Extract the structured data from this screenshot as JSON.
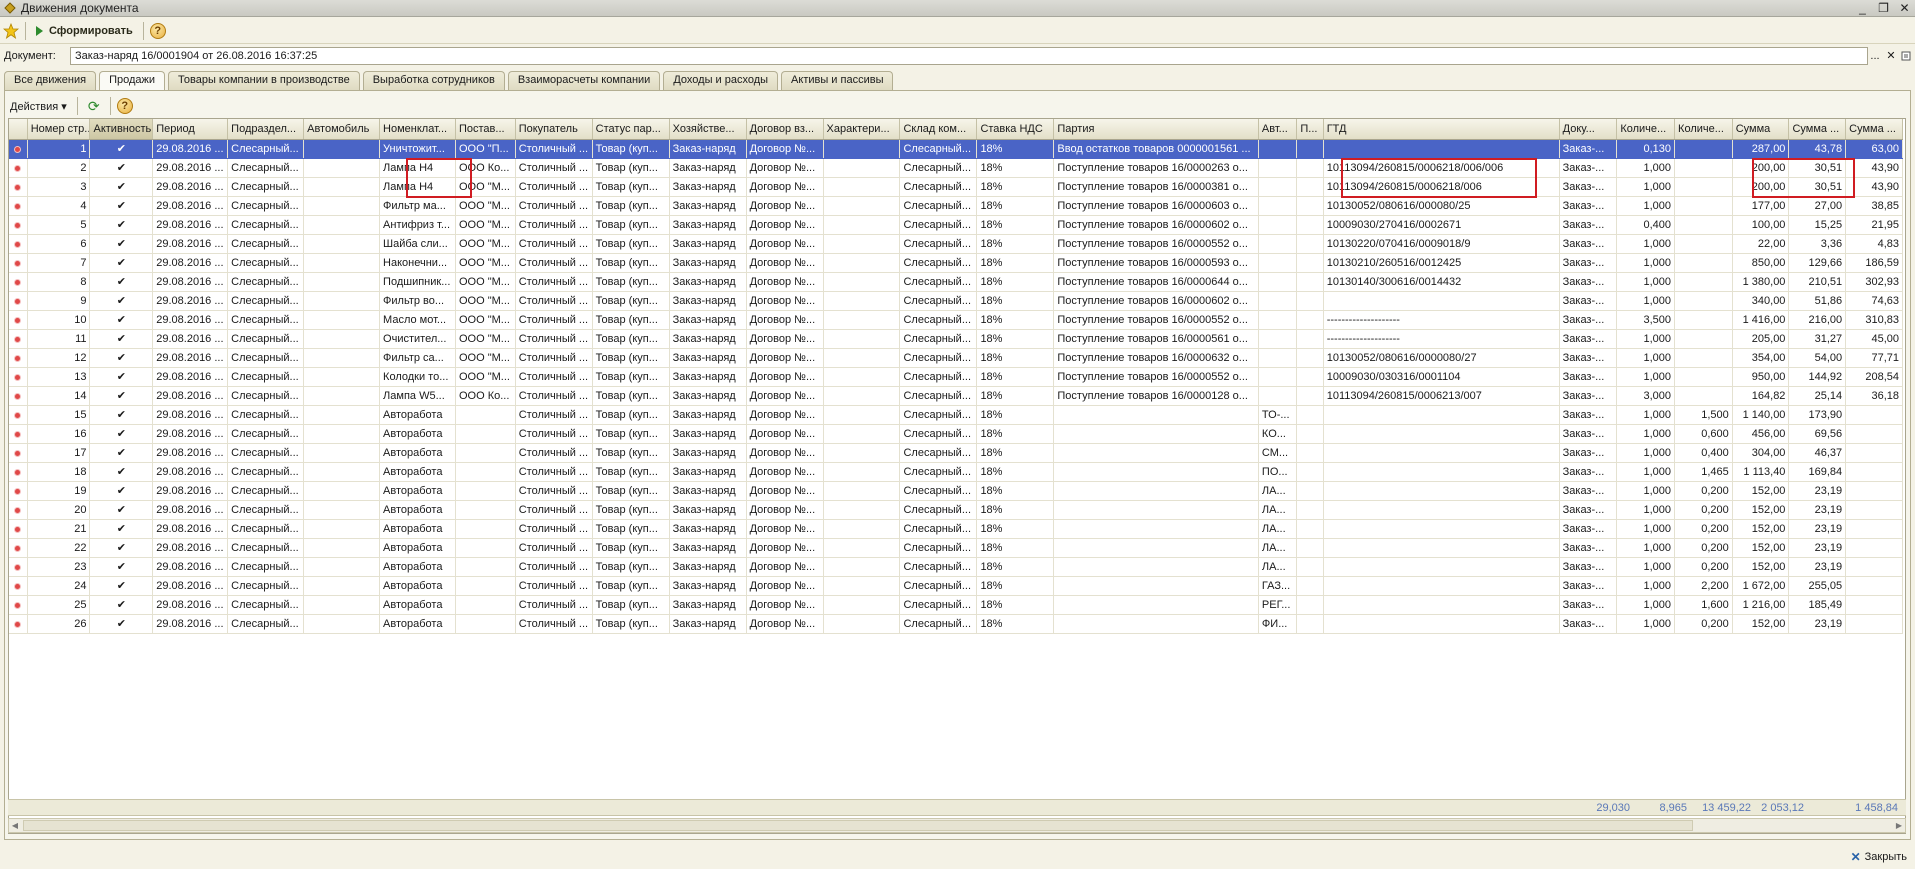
{
  "window": {
    "title": "Движения документа",
    "minimize": "_",
    "restore": "❐",
    "close": "✕"
  },
  "toolbar": {
    "form_label": "Сформировать",
    "help": "?"
  },
  "document": {
    "label": "Документ:",
    "value": "Заказ-наряд 16/0001904 от 26.08.2016 16:37:25",
    "select": "...",
    "clear": "✕"
  },
  "tabs": [
    "Все движения",
    "Продажи",
    "Товары компании в производстве",
    "Выработка сотрудников",
    "Взаиморасчеты компании",
    "Доходы и расходы",
    "Активы и пассивы"
  ],
  "actions": {
    "label": "Действия ▾",
    "refresh": "⟳",
    "help": "?"
  },
  "columns": [
    "",
    "Номер стр...",
    "Активность",
    "Период",
    "Подраздел...",
    "Автомобиль",
    "Номенклат...",
    "Постав...",
    "Покупатель",
    "Статус пар...",
    "Хозяйстве...",
    "Договор вз...",
    "Характери...",
    "Склад ком...",
    "Ставка НДС",
    "Партия",
    "Авт...",
    "П...",
    "ГТД",
    "Доку...",
    "Количе...",
    "Количе...",
    "Сумма",
    "Сумма ...",
    "Сумма ..."
  ],
  "rows": [
    [
      "1",
      "✔",
      "29.08.2016 ...",
      "Слесарный...",
      "",
      "Уничтожит...",
      "ООО \"П...",
      "Столичный ...",
      "Товар (куп...",
      "Заказ-наряд",
      "Договор №...",
      "",
      "Слесарный...",
      "18%",
      "Ввод остатков товаров 0000001561 ...",
      "",
      "",
      "",
      "Заказ-...",
      "0,130",
      "",
      "287,00",
      "43,78",
      "63,00"
    ],
    [
      "2",
      "✔",
      "29.08.2016 ...",
      "Слесарный...",
      "",
      "Лампа Н4",
      "ООО Ко...",
      "Столичный ...",
      "Товар (куп...",
      "Заказ-наряд",
      "Договор №...",
      "",
      "Слесарный...",
      "18%",
      "Поступление товаров 16/0000263 о...",
      "",
      "",
      "10113094/260815/0006218/006/006",
      "Заказ-...",
      "1,000",
      "",
      "200,00",
      "30,51",
      "43,90"
    ],
    [
      "3",
      "✔",
      "29.08.2016 ...",
      "Слесарный...",
      "",
      "Лампа Н4",
      "ООО \"М...",
      "Столичный ...",
      "Товар (куп...",
      "Заказ-наряд",
      "Договор №...",
      "",
      "Слесарный...",
      "18%",
      "Поступление товаров 16/0000381 о...",
      "",
      "",
      "10113094/260815/0006218/006",
      "Заказ-...",
      "1,000",
      "",
      "200,00",
      "30,51",
      "43,90"
    ],
    [
      "4",
      "✔",
      "29.08.2016 ...",
      "Слесарный...",
      "",
      "Фильтр ма...",
      "ООО \"М...",
      "Столичный ...",
      "Товар (куп...",
      "Заказ-наряд",
      "Договор №...",
      "",
      "Слесарный...",
      "18%",
      "Поступление товаров 16/0000603 о...",
      "",
      "",
      "10130052/080616/000080/25",
      "Заказ-...",
      "1,000",
      "",
      "177,00",
      "27,00",
      "38,85"
    ],
    [
      "5",
      "✔",
      "29.08.2016 ...",
      "Слесарный...",
      "",
      "Антифриз т...",
      "ООО \"М...",
      "Столичный ...",
      "Товар (куп...",
      "Заказ-наряд",
      "Договор №...",
      "",
      "Слесарный...",
      "18%",
      "Поступление товаров 16/0000602 о...",
      "",
      "",
      "10009030/270416/0002671",
      "Заказ-...",
      "0,400",
      "",
      "100,00",
      "15,25",
      "21,95"
    ],
    [
      "6",
      "✔",
      "29.08.2016 ...",
      "Слесарный...",
      "",
      "Шайба сли...",
      "ООО \"М...",
      "Столичный ...",
      "Товар (куп...",
      "Заказ-наряд",
      "Договор №...",
      "",
      "Слесарный...",
      "18%",
      "Поступление товаров 16/0000552 о...",
      "",
      "",
      "10130220/070416/0009018/9",
      "Заказ-...",
      "1,000",
      "",
      "22,00",
      "3,36",
      "4,83"
    ],
    [
      "7",
      "✔",
      "29.08.2016 ...",
      "Слесарный...",
      "",
      "Наконечни...",
      "ООО \"М...",
      "Столичный ...",
      "Товар (куп...",
      "Заказ-наряд",
      "Договор №...",
      "",
      "Слесарный...",
      "18%",
      "Поступление товаров 16/0000593 о...",
      "",
      "",
      "10130210/260516/0012425",
      "Заказ-...",
      "1,000",
      "",
      "850,00",
      "129,66",
      "186,59"
    ],
    [
      "8",
      "✔",
      "29.08.2016 ...",
      "Слесарный...",
      "",
      "Подшипник...",
      "ООО \"М...",
      "Столичный ...",
      "Товар (куп...",
      "Заказ-наряд",
      "Договор №...",
      "",
      "Слесарный...",
      "18%",
      "Поступление товаров 16/0000644 о...",
      "",
      "",
      "10130140/300616/0014432",
      "Заказ-...",
      "1,000",
      "",
      "1 380,00",
      "210,51",
      "302,93"
    ],
    [
      "9",
      "✔",
      "29.08.2016 ...",
      "Слесарный...",
      "",
      "Фильтр во...",
      "ООО \"М...",
      "Столичный ...",
      "Товар (куп...",
      "Заказ-наряд",
      "Договор №...",
      "",
      "Слесарный...",
      "18%",
      "Поступление товаров 16/0000602 о...",
      "",
      "",
      "",
      "Заказ-...",
      "1,000",
      "",
      "340,00",
      "51,86",
      "74,63"
    ],
    [
      "10",
      "✔",
      "29.08.2016 ...",
      "Слесарный...",
      "",
      "Масло мот...",
      "ООО \"М...",
      "Столичный ...",
      "Товар (куп...",
      "Заказ-наряд",
      "Договор №...",
      "",
      "Слесарный...",
      "18%",
      "Поступление товаров 16/0000552 о...",
      "",
      "",
      "--------------------",
      "Заказ-...",
      "3,500",
      "",
      "1 416,00",
      "216,00",
      "310,83"
    ],
    [
      "11",
      "✔",
      "29.08.2016 ...",
      "Слесарный...",
      "",
      "Очистител...",
      "ООО \"М...",
      "Столичный ...",
      "Товар (куп...",
      "Заказ-наряд",
      "Договор №...",
      "",
      "Слесарный...",
      "18%",
      "Поступление товаров 16/0000561 о...",
      "",
      "",
      "--------------------",
      "Заказ-...",
      "1,000",
      "",
      "205,00",
      "31,27",
      "45,00"
    ],
    [
      "12",
      "✔",
      "29.08.2016 ...",
      "Слесарный...",
      "",
      "Фильтр са...",
      "ООО \"М...",
      "Столичный ...",
      "Товар (куп...",
      "Заказ-наряд",
      "Договор №...",
      "",
      "Слесарный...",
      "18%",
      "Поступление товаров 16/0000632 о...",
      "",
      "",
      "10130052/080616/0000080/27",
      "Заказ-...",
      "1,000",
      "",
      "354,00",
      "54,00",
      "77,71"
    ],
    [
      "13",
      "✔",
      "29.08.2016 ...",
      "Слесарный...",
      "",
      "Колодки то...",
      "ООО \"М...",
      "Столичный ...",
      "Товар (куп...",
      "Заказ-наряд",
      "Договор №...",
      "",
      "Слесарный...",
      "18%",
      "Поступление товаров 16/0000552 о...",
      "",
      "",
      "10009030/030316/0001104",
      "Заказ-...",
      "1,000",
      "",
      "950,00",
      "144,92",
      "208,54"
    ],
    [
      "14",
      "✔",
      "29.08.2016 ...",
      "Слесарный...",
      "",
      "Лампа W5...",
      "ООО Ко...",
      "Столичный ...",
      "Товар (куп...",
      "Заказ-наряд",
      "Договор №...",
      "",
      "Слесарный...",
      "18%",
      "Поступление товаров 16/0000128 о...",
      "",
      "",
      "10113094/260815/0006213/007",
      "Заказ-...",
      "3,000",
      "",
      "164,82",
      "25,14",
      "36,18"
    ],
    [
      "15",
      "✔",
      "29.08.2016 ...",
      "Слесарный...",
      "",
      "Авторабота",
      "",
      "Столичный ...",
      "Товар (куп...",
      "Заказ-наряд",
      "Договор №...",
      "",
      "Слесарный...",
      "18%",
      "",
      "ТО-...",
      "",
      "",
      "Заказ-...",
      "1,000",
      "1,500",
      "1 140,00",
      "173,90",
      ""
    ],
    [
      "16",
      "✔",
      "29.08.2016 ...",
      "Слесарный...",
      "",
      "Авторабота",
      "",
      "Столичный ...",
      "Товар (куп...",
      "Заказ-наряд",
      "Договор №...",
      "",
      "Слесарный...",
      "18%",
      "",
      "КО...",
      "",
      "",
      "Заказ-...",
      "1,000",
      "0,600",
      "456,00",
      "69,56",
      ""
    ],
    [
      "17",
      "✔",
      "29.08.2016 ...",
      "Слесарный...",
      "",
      "Авторабота",
      "",
      "Столичный ...",
      "Товар (куп...",
      "Заказ-наряд",
      "Договор №...",
      "",
      "Слесарный...",
      "18%",
      "",
      "СМ...",
      "",
      "",
      "Заказ-...",
      "1,000",
      "0,400",
      "304,00",
      "46,37",
      ""
    ],
    [
      "18",
      "✔",
      "29.08.2016 ...",
      "Слесарный...",
      "",
      "Авторабота",
      "",
      "Столичный ...",
      "Товар (куп...",
      "Заказ-наряд",
      "Договор №...",
      "",
      "Слесарный...",
      "18%",
      "",
      "ПО...",
      "",
      "",
      "Заказ-...",
      "1,000",
      "1,465",
      "1 113,40",
      "169,84",
      ""
    ],
    [
      "19",
      "✔",
      "29.08.2016 ...",
      "Слесарный...",
      "",
      "Авторабота",
      "",
      "Столичный ...",
      "Товар (куп...",
      "Заказ-наряд",
      "Договор №...",
      "",
      "Слесарный...",
      "18%",
      "",
      "ЛА...",
      "",
      "",
      "Заказ-...",
      "1,000",
      "0,200",
      "152,00",
      "23,19",
      ""
    ],
    [
      "20",
      "✔",
      "29.08.2016 ...",
      "Слесарный...",
      "",
      "Авторабота",
      "",
      "Столичный ...",
      "Товар (куп...",
      "Заказ-наряд",
      "Договор №...",
      "",
      "Слесарный...",
      "18%",
      "",
      "ЛА...",
      "",
      "",
      "Заказ-...",
      "1,000",
      "0,200",
      "152,00",
      "23,19",
      ""
    ],
    [
      "21",
      "✔",
      "29.08.2016 ...",
      "Слесарный...",
      "",
      "Авторабота",
      "",
      "Столичный ...",
      "Товар (куп...",
      "Заказ-наряд",
      "Договор №...",
      "",
      "Слесарный...",
      "18%",
      "",
      "ЛА...",
      "",
      "",
      "Заказ-...",
      "1,000",
      "0,200",
      "152,00",
      "23,19",
      ""
    ],
    [
      "22",
      "✔",
      "29.08.2016 ...",
      "Слесарный...",
      "",
      "Авторабота",
      "",
      "Столичный ...",
      "Товар (куп...",
      "Заказ-наряд",
      "Договор №...",
      "",
      "Слесарный...",
      "18%",
      "",
      "ЛА...",
      "",
      "",
      "Заказ-...",
      "1,000",
      "0,200",
      "152,00",
      "23,19",
      ""
    ],
    [
      "23",
      "✔",
      "29.08.2016 ...",
      "Слесарный...",
      "",
      "Авторабота",
      "",
      "Столичный ...",
      "Товар (куп...",
      "Заказ-наряд",
      "Договор №...",
      "",
      "Слесарный...",
      "18%",
      "",
      "ЛА...",
      "",
      "",
      "Заказ-...",
      "1,000",
      "0,200",
      "152,00",
      "23,19",
      ""
    ],
    [
      "24",
      "✔",
      "29.08.2016 ...",
      "Слесарный...",
      "",
      "Авторабота",
      "",
      "Столичный ...",
      "Товар (куп...",
      "Заказ-наряд",
      "Договор №...",
      "",
      "Слесарный...",
      "18%",
      "",
      "ГАЗ...",
      "",
      "",
      "Заказ-...",
      "1,000",
      "2,200",
      "1 672,00",
      "255,05",
      ""
    ],
    [
      "25",
      "✔",
      "29.08.2016 ...",
      "Слесарный...",
      "",
      "Авторабота",
      "",
      "Столичный ...",
      "Товар (куп...",
      "Заказ-наряд",
      "Договор №...",
      "",
      "Слесарный...",
      "18%",
      "",
      "РЕГ...",
      "",
      "",
      "Заказ-...",
      "1,000",
      "1,600",
      "1 216,00",
      "185,49",
      ""
    ],
    [
      "26",
      "✔",
      "29.08.2016 ...",
      "Слесарный...",
      "",
      "Авторабота",
      "",
      "Столичный ...",
      "Товар (куп...",
      "Заказ-наряд",
      "Договор №...",
      "",
      "Слесарный...",
      "18%",
      "",
      "ФИ...",
      "",
      "",
      "Заказ-...",
      "1,000",
      "0,200",
      "152,00",
      "23,19",
      ""
    ]
  ],
  "totals": {
    "qty1": "29,030",
    "qty2": "8,965",
    "sum": "13 459,22",
    "sum2": "2 053,12",
    "sum3": "1 458,84"
  },
  "footer": {
    "close_label": "Закрыть"
  },
  "colors": {
    "selection": "#4a64c6",
    "highlight_frame": "#d01c22",
    "totals_text": "#5a78b8"
  }
}
